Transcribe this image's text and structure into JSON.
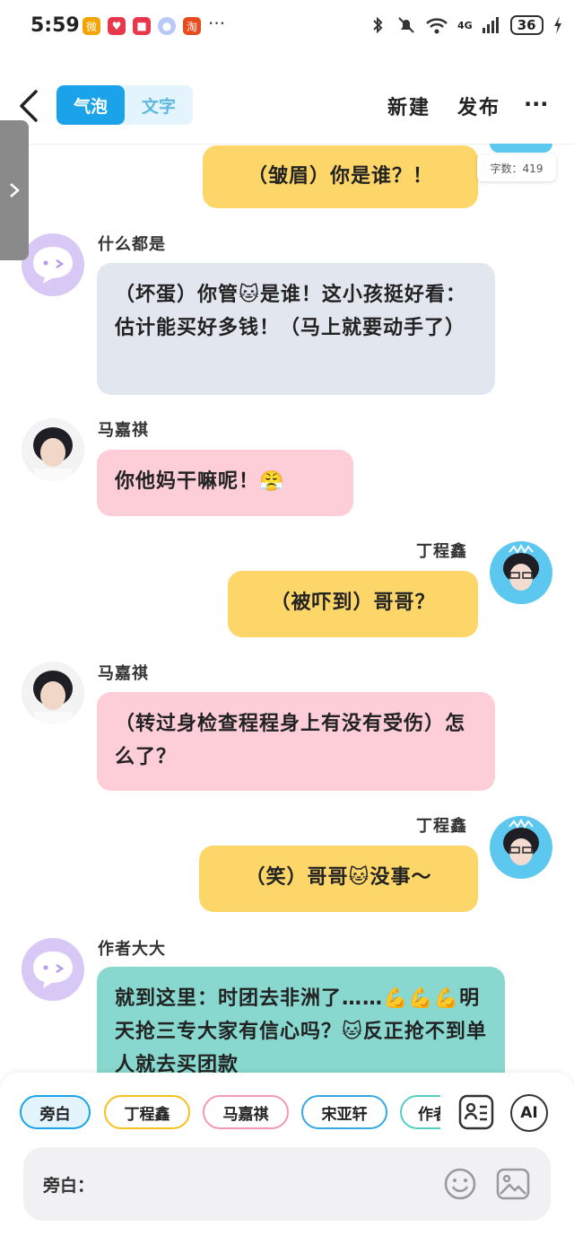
{
  "status_bar": {
    "time": "5:59",
    "apps": [
      {
        "icon": "weibo-icon",
        "color": "#f5a300",
        "glyph": "微"
      },
      {
        "icon": "app-red-heart-icon",
        "color": "#e8364a",
        "glyph": "♥"
      },
      {
        "icon": "huawei-mall-icon",
        "color": "#e8364a",
        "glyph": "■"
      },
      {
        "icon": "color-ball-icon",
        "color": "#b8c8f8",
        "glyph": "●"
      },
      {
        "icon": "taobao-icon",
        "color": "#e84b1c",
        "glyph": "淘"
      }
    ],
    "more": "···",
    "network": "4G",
    "battery": "36"
  },
  "header": {
    "segments": [
      "气泡",
      "文字"
    ],
    "new_label": "新建",
    "publish_label": "发布",
    "more_label": "···"
  },
  "word_count": "字数：419",
  "messages": [
    {
      "speaker": "",
      "text": "（皱眉）你是谁？！",
      "side": "right"
    },
    {
      "speaker": "什么都是",
      "text": "（坏蛋）你管🐱是谁！这小孩挺好看：估计能买好多钱！（马上就要动手了）",
      "side": "left"
    },
    {
      "speaker": "马嘉祺",
      "text": "你他妈干嘛呢！😤",
      "side": "left"
    },
    {
      "speaker": "丁程鑫",
      "text": "（被吓到）哥哥？",
      "side": "right"
    },
    {
      "speaker": "马嘉祺",
      "text": "（转过身检查程程身上有没有受伤）怎么了？",
      "side": "left"
    },
    {
      "speaker": "丁程鑫",
      "text": "（笑）哥哥🐱没事～",
      "side": "right"
    },
    {
      "speaker": "作者大大",
      "text": "就到这里：时团去非洲了……💪💪💪明天抢三专大家有信心吗？🐱反正抢不到单人就去买团款",
      "side": "left"
    }
  ],
  "roles": [
    {
      "label": "旁白",
      "color": "#1aa3e8",
      "selected": true
    },
    {
      "label": "丁程鑫",
      "color": "#f3c21d",
      "selected": false
    },
    {
      "label": "马嘉祺",
      "color": "#f29ab4",
      "selected": false
    },
    {
      "label": "宋亚轩",
      "color": "#35a8e0",
      "selected": false
    },
    {
      "label": "作者",
      "color": "#52cfc0",
      "selected": false
    }
  ],
  "input": {
    "placeholder": "旁白："
  },
  "tools": {
    "ai_label": "AI"
  }
}
